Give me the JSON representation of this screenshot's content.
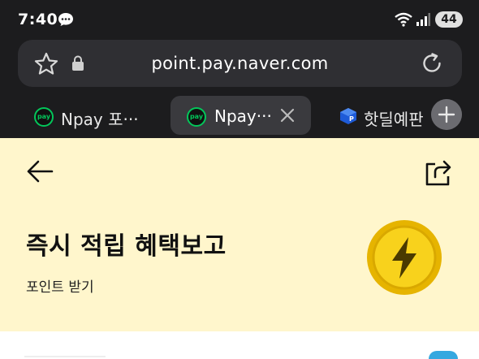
{
  "status_bar": {
    "time": "7:40",
    "battery_level": "44",
    "icons": [
      "chat-bubble-icon",
      "wifi-icon",
      "signal-icon"
    ]
  },
  "url_bar": {
    "url": "point.pay.naver.com",
    "icons": [
      "star-icon",
      "lock-icon",
      "reload-icon"
    ]
  },
  "tabs": [
    {
      "favicon": "pay",
      "title": "Npay 포···",
      "active": false
    },
    {
      "favicon": "pay",
      "title": "Npay···",
      "active": true
    },
    {
      "favicon": "hotdeal-icon",
      "title": "핫딜예판",
      "active": false
    }
  ],
  "page": {
    "title": "즉시 적립 혜택보고",
    "subtitle": "포인트 받기",
    "icons": [
      "back-arrow-icon",
      "share-icon",
      "lightning-coin-icon"
    ]
  },
  "colors": {
    "browser_bg": "#1c1c1e",
    "banner_bg": "#fff6cc",
    "coin_gold": "#f2c200",
    "naver_green": "#03c75a"
  }
}
